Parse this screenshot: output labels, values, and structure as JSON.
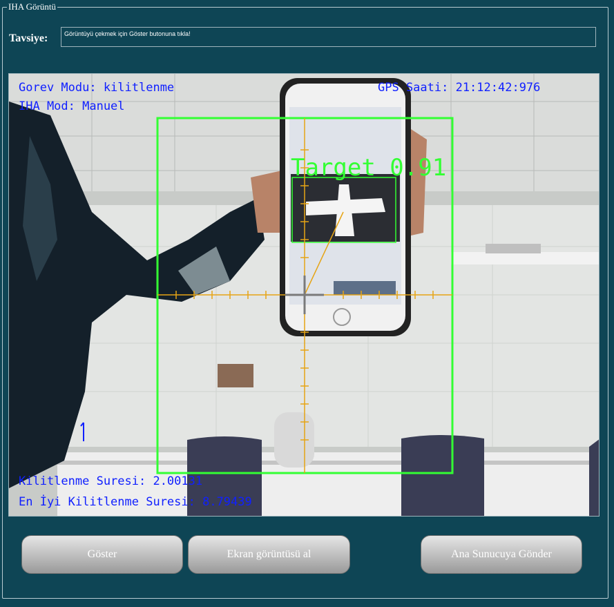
{
  "group_title": "IHA Görüntü",
  "advice": {
    "label": "Tavsiye:",
    "text": "Görüntüyü çekmek için Göster butonuna tıkla!"
  },
  "video": {
    "mode": "Gorev Modu: kilitlenme",
    "uav_mode": "IHA Mod: Manuel",
    "gps_time": "GPS Saati: 21:12:42:976",
    "target_label": "Target 0.91",
    "lock_duration": "Kilitlenme Suresi: 2.00131",
    "best_lock_duration": "En İyi Kilitlenme Suresi: 8.79439",
    "osd_color": "#1020ff",
    "box_color": "#33ff33",
    "crosshair_color": "#e6a414"
  },
  "buttons": {
    "show": "Göster",
    "screenshot": "Ekran görüntüsü al",
    "send": "Ana Sunucuya Gönder"
  }
}
